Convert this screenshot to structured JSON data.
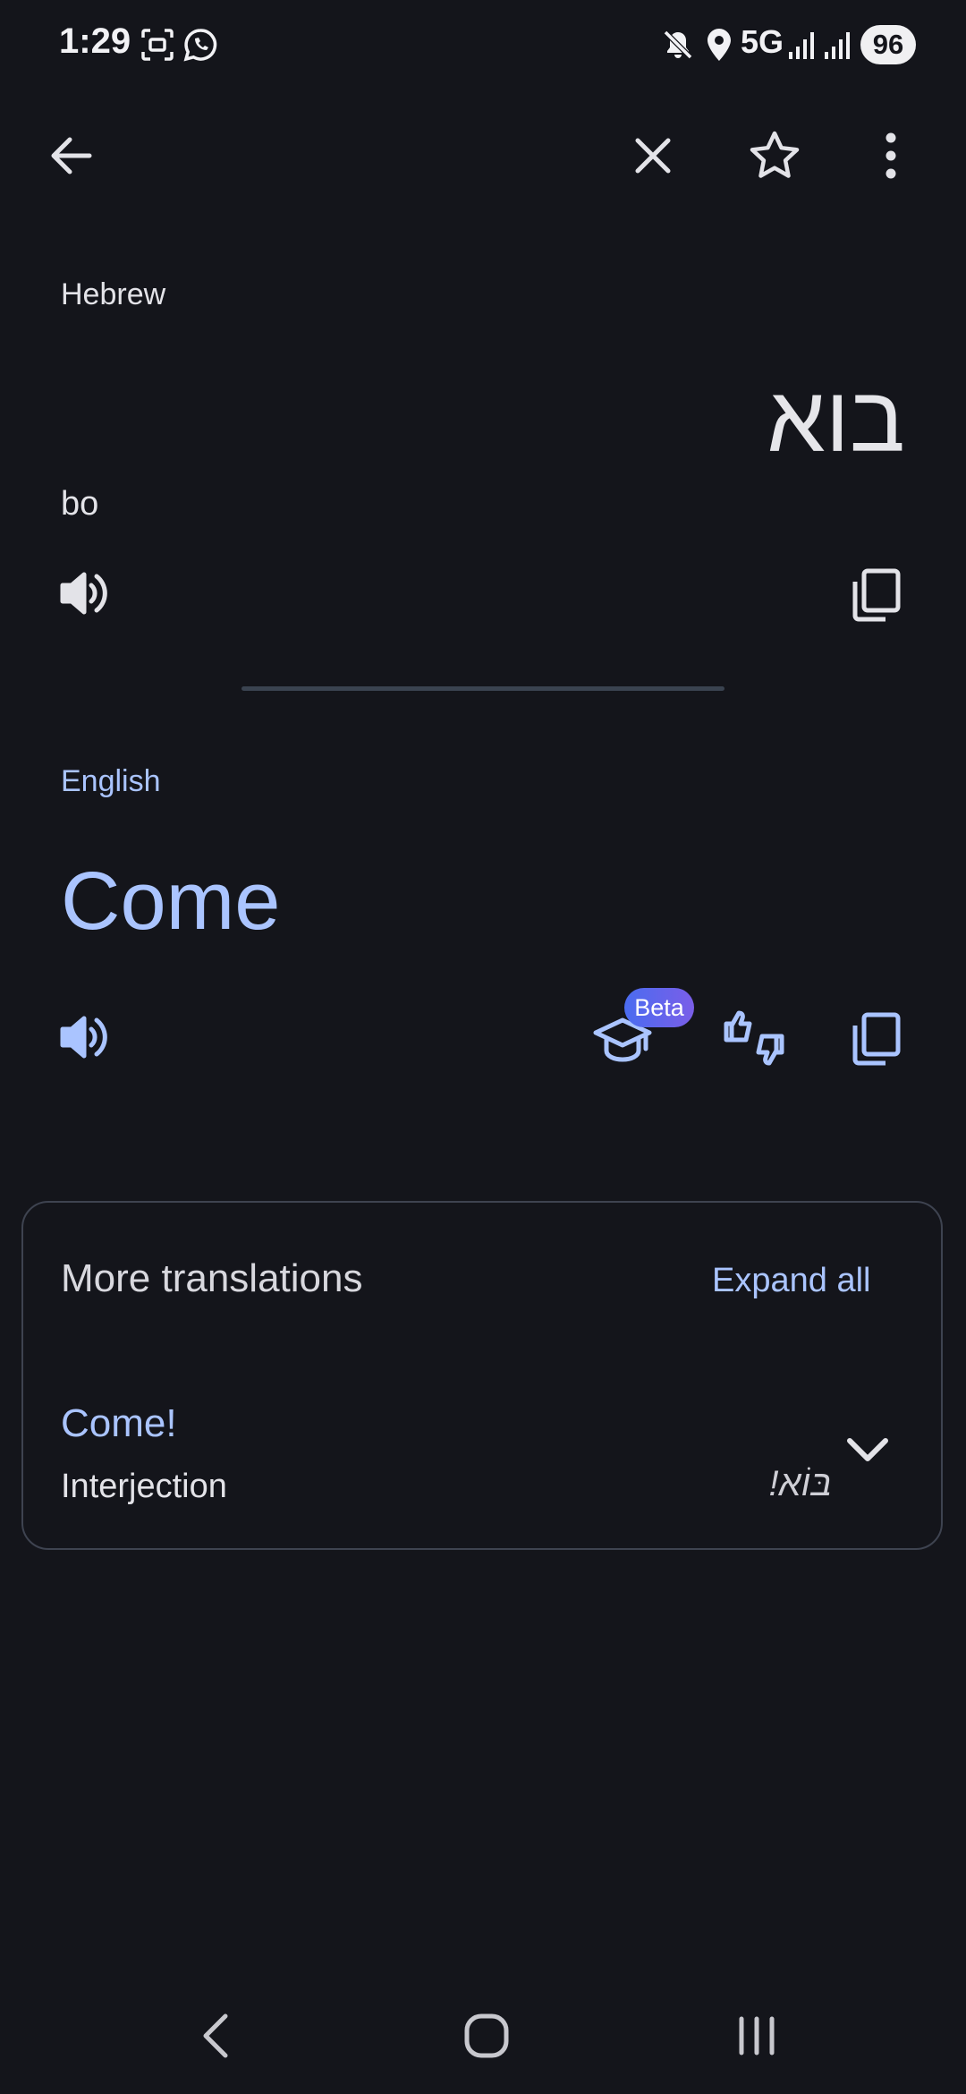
{
  "status_bar": {
    "time": "1:29",
    "network": "5G",
    "battery": "96",
    "icons": [
      "screenshot-icon",
      "whatsapp-icon",
      "mute-icon",
      "location-icon",
      "signal-icon",
      "signal-icon"
    ]
  },
  "top_bar": {
    "icons": [
      "back-arrow-icon",
      "close-icon",
      "star-icon",
      "more-vert-icon"
    ]
  },
  "source": {
    "language": "Hebrew",
    "text": "בוא",
    "transliteration": "bo"
  },
  "target": {
    "language": "English",
    "text": "Come",
    "beta_badge": "Beta"
  },
  "more_translations": {
    "title": "More translations",
    "expand_label": "Expand all",
    "entries": [
      {
        "word": "Come!",
        "part_of_speech": "Interjection",
        "source": "בּוֹא!"
      }
    ]
  },
  "colors": {
    "background": "#14151b",
    "accent": "#aac4ff",
    "divider": "#3a4350"
  }
}
